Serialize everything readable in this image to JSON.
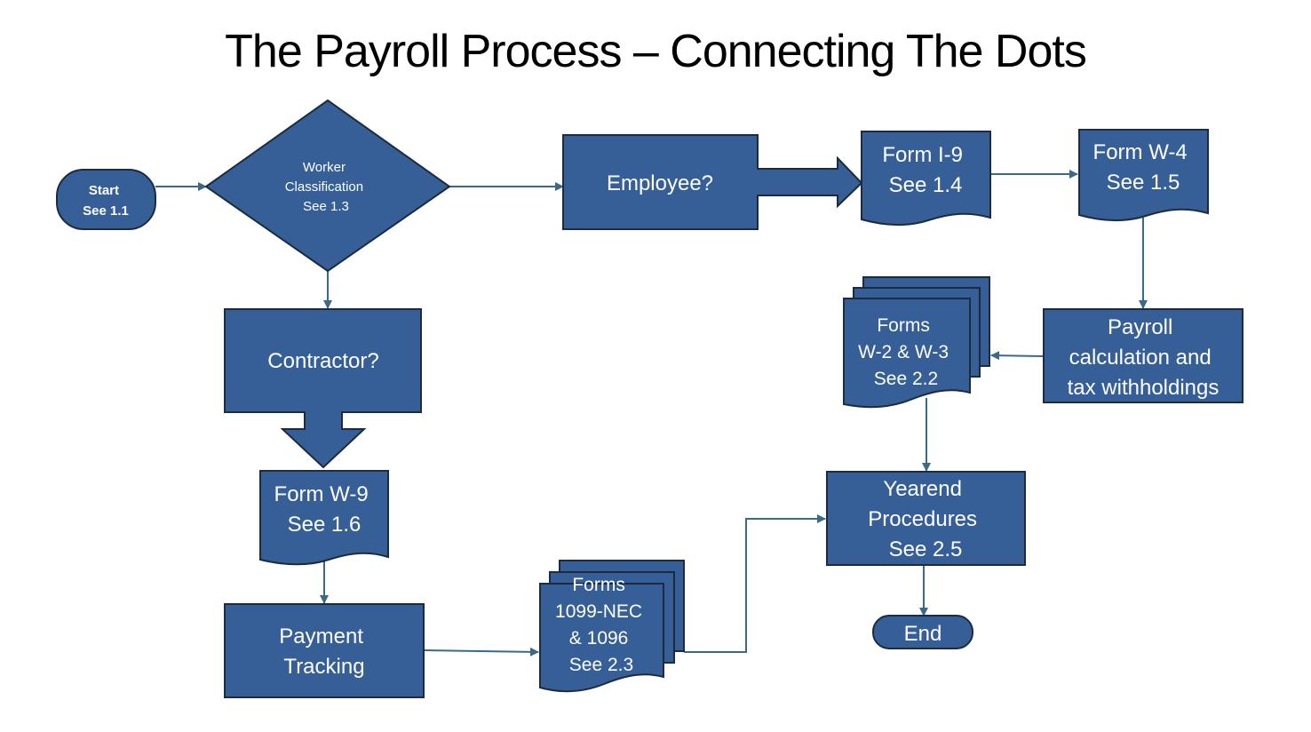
{
  "title": "The Payroll Process – Connecting The Dots",
  "colors": {
    "shape_fill": "#355f96",
    "shape_stroke": "#1c2b3d",
    "connector": "#3a6a88",
    "text": "#ffffff"
  },
  "nodes": {
    "start": {
      "type": "terminator",
      "lines": [
        "Start",
        "See 1.1"
      ]
    },
    "worker_classification": {
      "type": "decision",
      "lines": [
        "Worker",
        "Classification",
        "See 1.3"
      ]
    },
    "employee": {
      "type": "process-arrow",
      "lines": [
        "Employee?"
      ]
    },
    "form_i9": {
      "type": "document",
      "lines": [
        "Form I-9",
        "See 1.4"
      ]
    },
    "form_w4": {
      "type": "document",
      "lines": [
        "Form W-4",
        "See 1.5"
      ]
    },
    "payroll_calc": {
      "type": "process",
      "lines": [
        "Payroll",
        "calculation and",
        "tax withholdings"
      ]
    },
    "forms_w2_w3": {
      "type": "multi-document",
      "lines": [
        "Forms",
        "W-2 & W-3",
        "See 2.2"
      ]
    },
    "contractor": {
      "type": "process-arrow",
      "lines": [
        "Contractor?"
      ]
    },
    "form_w9": {
      "type": "document",
      "lines": [
        "Form W-9",
        "See 1.6"
      ]
    },
    "payment_tracking": {
      "type": "process",
      "lines": [
        "Payment",
        "Tracking"
      ]
    },
    "forms_1099": {
      "type": "multi-document",
      "lines": [
        "Forms",
        "1099-NEC",
        "& 1096",
        "See 2.3"
      ]
    },
    "yearend": {
      "type": "process",
      "lines": [
        "Yearend",
        "Procedures",
        "See 2.5"
      ]
    },
    "end": {
      "type": "terminator",
      "lines": [
        "End"
      ]
    }
  },
  "edges": [
    {
      "from": "start",
      "to": "worker_classification"
    },
    {
      "from": "worker_classification",
      "to": "employee"
    },
    {
      "from": "worker_classification",
      "to": "contractor"
    },
    {
      "from": "employee",
      "to": "form_i9"
    },
    {
      "from": "form_i9",
      "to": "form_w4"
    },
    {
      "from": "form_w4",
      "to": "payroll_calc"
    },
    {
      "from": "payroll_calc",
      "to": "forms_w2_w3"
    },
    {
      "from": "forms_w2_w3",
      "to": "yearend"
    },
    {
      "from": "contractor",
      "to": "form_w9"
    },
    {
      "from": "form_w9",
      "to": "payment_tracking"
    },
    {
      "from": "payment_tracking",
      "to": "forms_1099"
    },
    {
      "from": "forms_1099",
      "to": "yearend"
    },
    {
      "from": "yearend",
      "to": "end"
    }
  ]
}
